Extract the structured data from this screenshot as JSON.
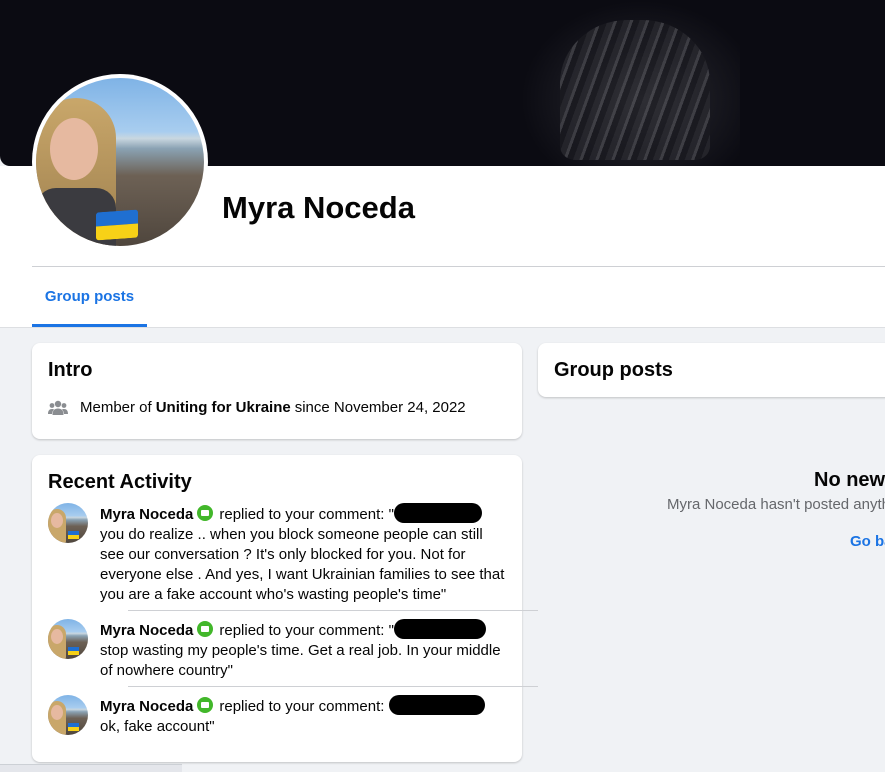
{
  "profile": {
    "name": "Myra Noceda"
  },
  "tabs": [
    {
      "label": "Group posts",
      "active": true
    }
  ],
  "intro": {
    "title": "Intro",
    "member_prefix": "Member of",
    "group_name": "Uniting for Ukraine",
    "member_suffix": "since November 24, 2022"
  },
  "recent_activity": {
    "title": "Recent Activity",
    "items": [
      {
        "name": "Myra Noceda",
        "action": "replied to your comment: \"",
        "text": "you do realize .. when you block someone people can still see our conversation ? It's only blocked for you. Not for everyone else . And yes, I want Ukrainian families to see that you are a fake account who's wasting people's time\""
      },
      {
        "name": "Myra Noceda",
        "action": "replied to your comment: \"",
        "text": "stop wasting my people's time. Get a real job. In your middle of nowhere country\""
      },
      {
        "name": "Myra Noceda",
        "action": "replied to your comment: ",
        "text": "ok, fake account\""
      }
    ]
  },
  "group_posts": {
    "title": "Group posts",
    "empty_title": "No new",
    "empty_subtitle": "Myra Noceda hasn't posted anyth",
    "link": "Go ba"
  },
  "colors": {
    "accent": "#1b74e4",
    "comment_badge": "#42b72a",
    "ukraine_blue": "#1f6fd1",
    "ukraine_yellow": "#f7d117"
  },
  "icons": {
    "intro_row": "people-icon",
    "activity_badge": "comment-icon"
  }
}
